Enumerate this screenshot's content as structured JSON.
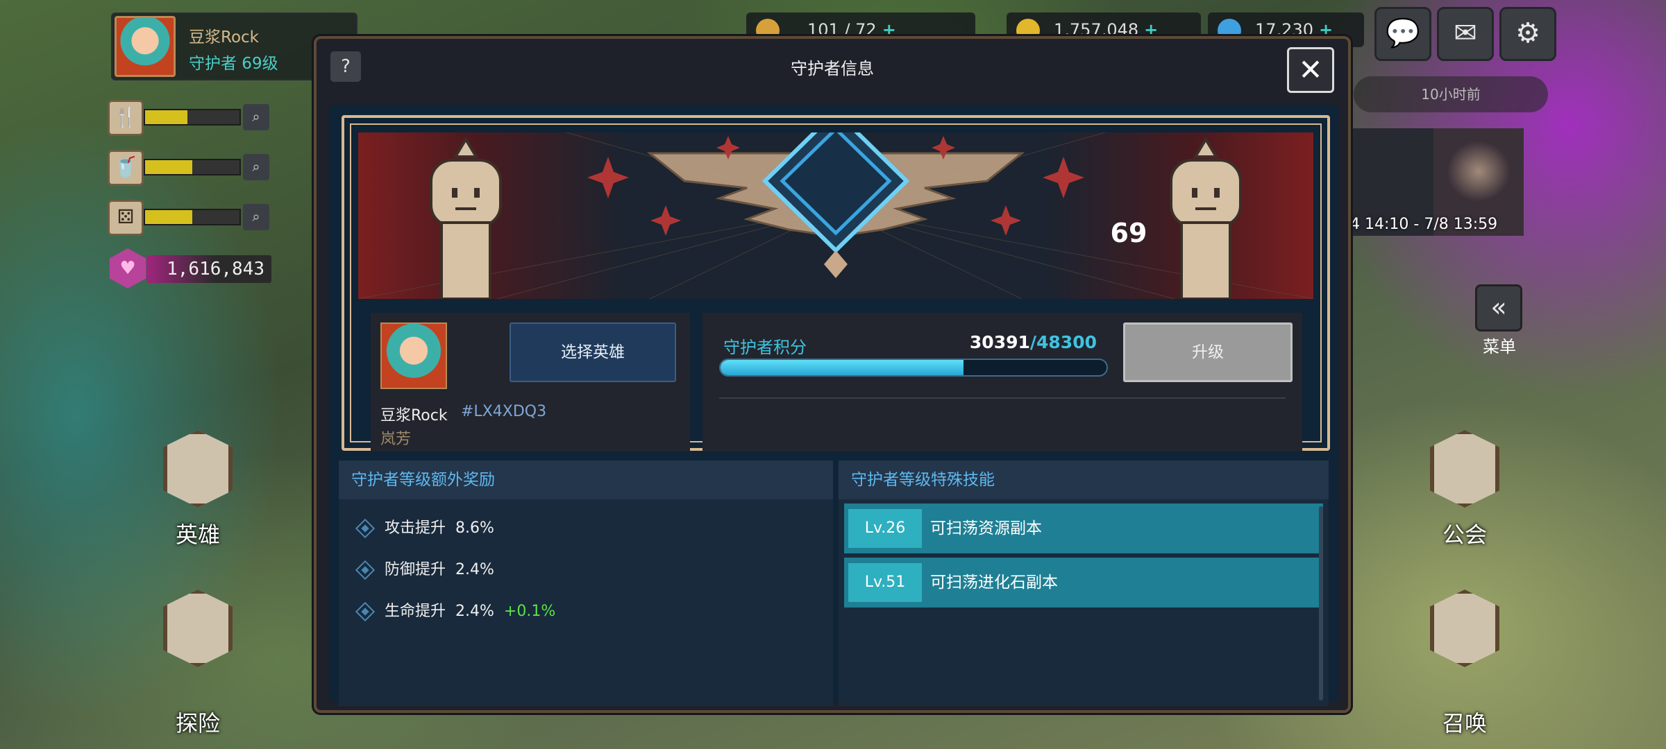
{
  "profile": {
    "name": "豆浆Rock",
    "level_text": "守护者 69级"
  },
  "stats": [
    {
      "icon": "fork-knife-icon",
      "glyph": "🍴",
      "fill": 0.45
    },
    {
      "icon": "cup-icon",
      "glyph": "🥤",
      "fill": 0.5
    },
    {
      "icon": "dice-icon",
      "glyph": "⚄",
      "fill": 0.5
    }
  ],
  "gems": {
    "value": "1,616,843"
  },
  "resources": [
    {
      "icon": "ticket-icon",
      "value": "101 / 72",
      "color": "#d6a13a"
    },
    {
      "icon": "gold-coin-icon",
      "value": "1,757,048",
      "color": "#e2b72b"
    },
    {
      "icon": "crystal-icon",
      "value": "17,230",
      "color": "#3fa0e0"
    }
  ],
  "top_buttons": [
    {
      "icon": "chat-icon",
      "glyph": "💬"
    },
    {
      "icon": "mail-icon",
      "glyph": "✉"
    },
    {
      "icon": "settings-icon",
      "glyph": "⚙"
    }
  ],
  "event": {
    "timer": "10小时前",
    "dates": "4  14:10 - 7/8  13:59"
  },
  "menu": {
    "glyph": "«",
    "label": "菜单"
  },
  "side_nav": {
    "hero": "英雄",
    "adventure": "探险",
    "guild": "公会",
    "summon": "召唤"
  },
  "dialog": {
    "title": "守护者信息",
    "help": "?",
    "close": "✕",
    "level": "69",
    "player": {
      "name": "豆浆Rock",
      "id": "#LX4XDQ3",
      "hero": "岚芳",
      "select_button": "选择英雄"
    },
    "points": {
      "label": "守护者积分",
      "current": "30391",
      "max": "/48300",
      "progress": 0.63
    },
    "upgrade_button": "升级",
    "bonus": {
      "header": "守护者等级额外奖励",
      "items": [
        {
          "label": "攻击提升",
          "value": "8.6%",
          "bonus": ""
        },
        {
          "label": "防御提升",
          "value": "2.4%",
          "bonus": ""
        },
        {
          "label": "生命提升",
          "value": "2.4%",
          "bonus": "+0.1%"
        }
      ]
    },
    "skills": {
      "header": "守护者等级特殊技能",
      "items": [
        {
          "level": "Lv.26",
          "desc": "可扫荡资源副本"
        },
        {
          "level": "Lv.51",
          "desc": "可扫荡进化石副本"
        }
      ]
    }
  }
}
